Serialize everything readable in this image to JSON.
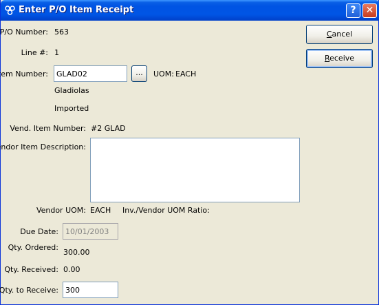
{
  "window": {
    "title": "Enter P/O Item Receipt",
    "help": "?",
    "close": "✕"
  },
  "buttons": {
    "cancel_prefix": "C",
    "cancel_rest": "ancel",
    "receive_prefix": "R",
    "receive_rest": "eceive",
    "lookup": "..."
  },
  "fields": {
    "po_number": {
      "label": "P/O Number:",
      "value": "563"
    },
    "line_no": {
      "label": "Line #:",
      "value": "1"
    },
    "item_number": {
      "label": "Item Number:",
      "value": "GLAD02"
    },
    "uom": {
      "label": "UOM:",
      "value": "EACH"
    },
    "item_desc1": "Gladiolas",
    "item_desc2": "Imported",
    "vend_item_number": {
      "label": "Vend. Item Number:",
      "value": "#2 GLAD"
    },
    "vendor_item_desc": {
      "label": "Vendor Item Description:",
      "value": ""
    },
    "vendor_uom": {
      "label": "Vendor UOM:",
      "value": "EACH"
    },
    "uom_ratio": {
      "label": "Inv./Vendor UOM Ratio:",
      "value": ""
    },
    "due_date": {
      "label": "Due Date:",
      "value": "10/01/2003"
    },
    "qty_ordered": {
      "label": "Qty. Ordered:",
      "value": "300.00"
    },
    "qty_received": {
      "label": "Qty. Received:",
      "value": "0.00"
    },
    "qty_to_receive": {
      "label": "Qty. to Receive:",
      "value": "300"
    }
  },
  "colors": {
    "titlebar": "#0054e3",
    "face": "#ece9d8",
    "field_border": "#7f9db9"
  }
}
